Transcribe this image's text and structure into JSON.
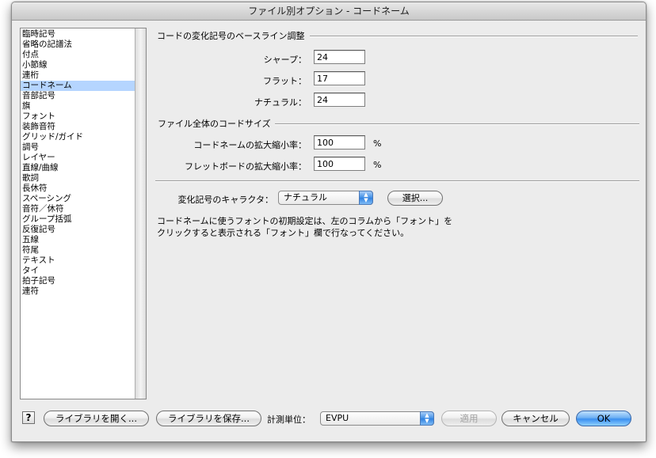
{
  "window": {
    "title": "ファイル別オプション - コードネーム"
  },
  "sidebar": {
    "items": [
      {
        "label": "臨時記号",
        "selected": false
      },
      {
        "label": "省略の記譜法",
        "selected": false
      },
      {
        "label": "付点",
        "selected": false
      },
      {
        "label": "小節線",
        "selected": false
      },
      {
        "label": "連桁",
        "selected": false
      },
      {
        "label": "コードネーム",
        "selected": true
      },
      {
        "label": "音部記号",
        "selected": false
      },
      {
        "label": "旗",
        "selected": false
      },
      {
        "label": "フォント",
        "selected": false
      },
      {
        "label": "装飾音符",
        "selected": false
      },
      {
        "label": "グリッド/ガイド",
        "selected": false
      },
      {
        "label": "調号",
        "selected": false
      },
      {
        "label": "レイヤー",
        "selected": false
      },
      {
        "label": "直線/曲線",
        "selected": false
      },
      {
        "label": "歌詞",
        "selected": false
      },
      {
        "label": "長休符",
        "selected": false
      },
      {
        "label": "スペーシング",
        "selected": false
      },
      {
        "label": "音符／休符",
        "selected": false
      },
      {
        "label": "グループ括弧",
        "selected": false
      },
      {
        "label": "反復記号",
        "selected": false
      },
      {
        "label": "五線",
        "selected": false
      },
      {
        "label": "符尾",
        "selected": false
      },
      {
        "label": "テキスト",
        "selected": false
      },
      {
        "label": "タイ",
        "selected": false
      },
      {
        "label": "拍子記号",
        "selected": false
      },
      {
        "label": "連符",
        "selected": false
      }
    ]
  },
  "baseline": {
    "title": "コードの変化記号のベースライン調整",
    "sharp_label": "シャープ：",
    "sharp_value": "24",
    "flat_label": "フラット：",
    "flat_value": "17",
    "natural_label": "ナチュラル：",
    "natural_value": "24"
  },
  "size": {
    "title": "ファイル全体のコードサイズ",
    "chord_label": "コードネームの拡大縮小率：",
    "chord_value": "100",
    "chord_unit": "%",
    "fretboard_label": "フレットボードの拡大縮小率：",
    "fretboard_value": "100",
    "fretboard_unit": "%"
  },
  "accidental": {
    "label": "変化記号のキャラクタ：",
    "selected": "ナチュラル",
    "select_button": "選択..."
  },
  "note": {
    "line1": "コードネームに使うフォントの初期設定は、左のコラムから「フォント」を",
    "line2": "クリックすると表示される「フォント」欄で行なってください。"
  },
  "footer": {
    "help": "?",
    "open_library": "ライブラリを開く...",
    "save_library": "ライブラリを保存...",
    "units_label": "計測単位：",
    "units_value": "EVPU",
    "apply": "適用",
    "cancel": "キャンセル",
    "ok": "OK"
  }
}
